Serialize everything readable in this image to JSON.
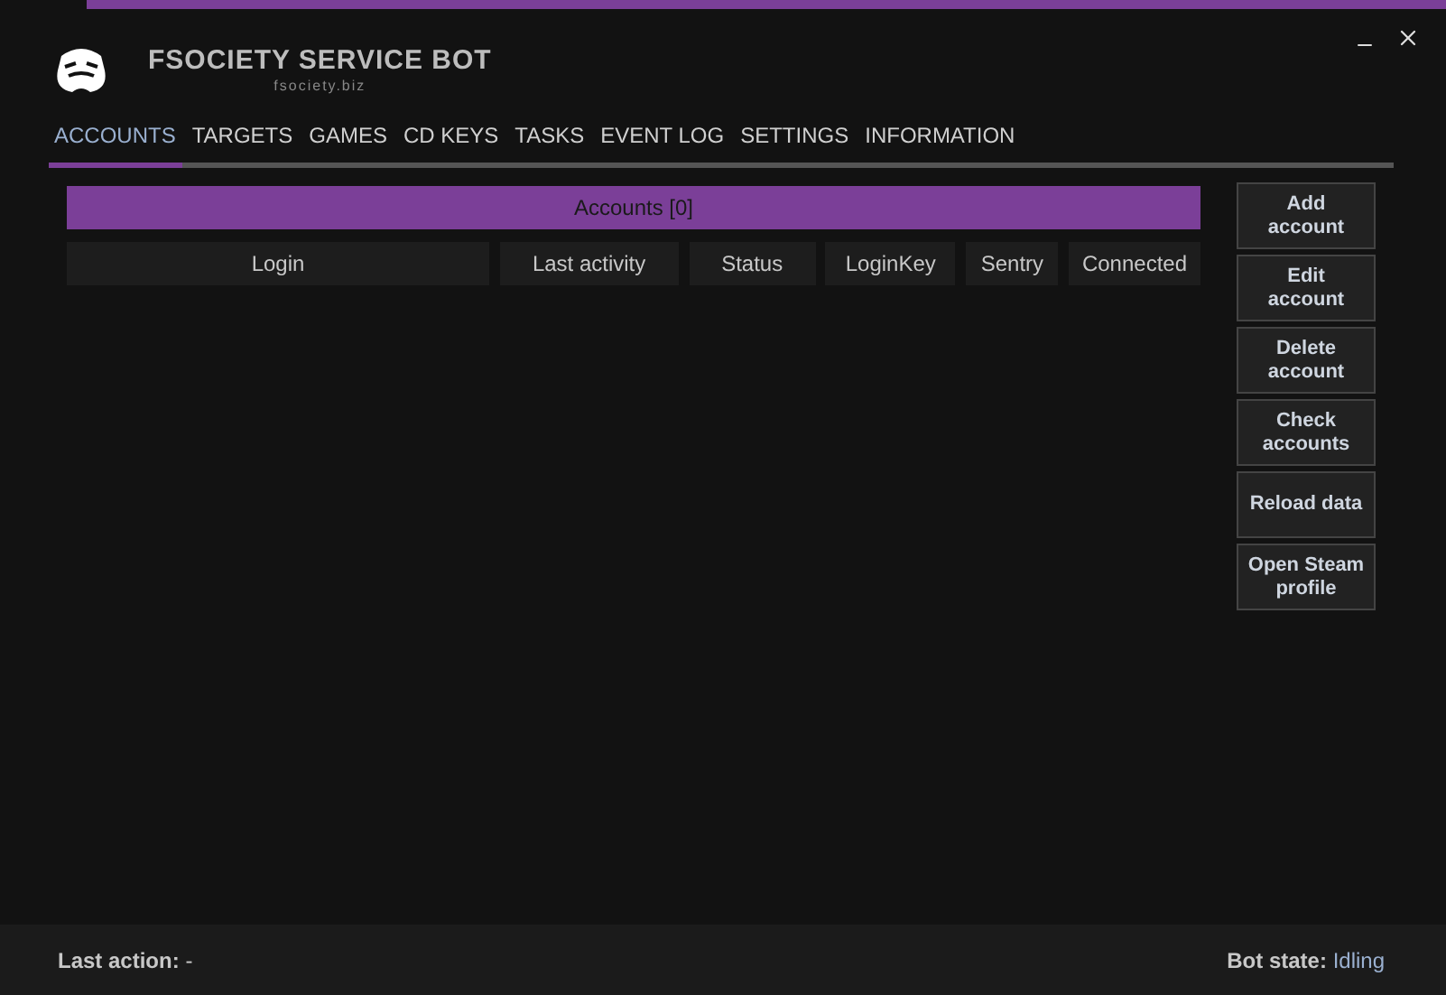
{
  "window": {
    "title": "FSOCIETY SERVICE BOT",
    "subtitle": "fsociety.biz"
  },
  "tabs": [
    {
      "label": "ACCOUNTS",
      "selected": true
    },
    {
      "label": "TARGETS",
      "selected": false
    },
    {
      "label": "GAMES",
      "selected": false
    },
    {
      "label": "CD KEYS",
      "selected": false
    },
    {
      "label": "TASKS",
      "selected": false
    },
    {
      "label": "EVENT LOG",
      "selected": false
    },
    {
      "label": "SETTINGS",
      "selected": false
    },
    {
      "label": "INFORMATION",
      "selected": false
    }
  ],
  "table": {
    "title": "Accounts [0]",
    "columns": [
      "Login",
      "Last activity",
      "Status",
      "LoginKey",
      "Sentry",
      "Connected"
    ]
  },
  "buttons": [
    "Add account",
    "Edit account",
    "Delete account",
    "Check accounts",
    "Reload data",
    "Open Steam profile"
  ],
  "status_bar": {
    "last_action_label": "Last action:",
    "last_action": "-",
    "bot_state_label": "Bot state:",
    "bot_state": "Idling"
  }
}
